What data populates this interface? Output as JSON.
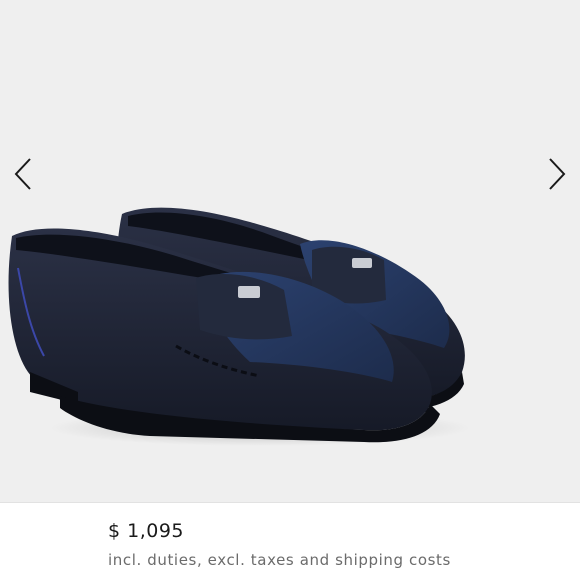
{
  "gallery": {
    "image_alt": "Navy leather and suede penny loafers",
    "prev_icon": "chevron-left-icon",
    "next_icon": "chevron-right-icon"
  },
  "product": {
    "price": "$ 1,095",
    "price_note": "incl. duties, excl. taxes and shipping costs"
  },
  "colors": {
    "background": "#efefef",
    "leather": "#1c2233",
    "suede": "#23355c",
    "price_text": "#1a1a1a",
    "note_text": "#6b6b6b"
  }
}
